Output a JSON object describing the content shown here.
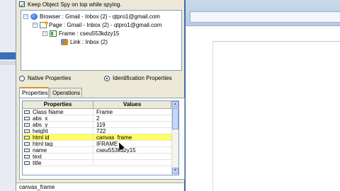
{
  "spy_dialog": {
    "keep_on_top_label": "Keep Object Spy on top while spying.",
    "tree": [
      {
        "label": "Browser : Gmail - Inbox (2) - qtpro1@gmail.com",
        "icon": "browser-icon",
        "expander": "-"
      },
      {
        "label": "Page : Gmail - Inbox (2) - qtpro1@gmail.com",
        "icon": "page-icon",
        "expander": "-"
      },
      {
        "label": "Frame : cseu553kdzy15",
        "icon": "frame-icon",
        "expander": "-"
      },
      {
        "label": "Link : Inbox (2)",
        "icon": "link-icon",
        "expander": ""
      }
    ],
    "radios": {
      "native_label": "Native Properties",
      "identification_label": "Identification Properties",
      "selected": "Identification Properties"
    },
    "tabs": [
      "Properties",
      "Operations"
    ],
    "active_tab": "Properties",
    "grid": {
      "headers": [
        "Properties",
        "Values"
      ],
      "rows": [
        {
          "name": "Class Name",
          "value": "Frame"
        },
        {
          "name": "abs_x",
          "value": "2"
        },
        {
          "name": "abs_y",
          "value": "119"
        },
        {
          "name": "height",
          "value": "722"
        },
        {
          "name": "html id",
          "value": "canvas_frame"
        },
        {
          "name": "html tag",
          "value": "IFRAME"
        },
        {
          "name": "name",
          "value": "cseu553kdzy15"
        },
        {
          "name": "text",
          "value": ""
        },
        {
          "name": "title",
          "value": ""
        }
      ],
      "selected_row": "html id"
    },
    "status_text": "canvas_frame"
  },
  "colors": {
    "dialog_bg": "#ece9d8",
    "selection_highlight": "#ffff60",
    "tab_accent": "#e68b2c"
  }
}
